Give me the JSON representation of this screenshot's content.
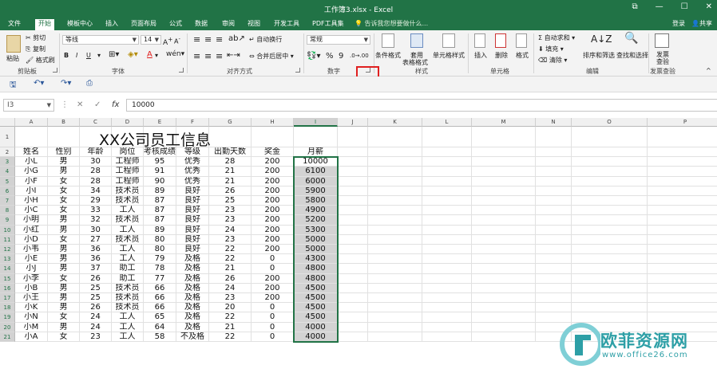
{
  "window": {
    "title": "工作簿3.xlsx - Excel",
    "controls": [
      "restore-icon",
      "minimize-icon",
      "maximize-icon",
      "close-icon"
    ]
  },
  "tabs": [
    "文件",
    "开始",
    "模板中心",
    "插入",
    "页面布局",
    "公式",
    "数据",
    "审阅",
    "视图",
    "开发工具",
    "PDF工具集"
  ],
  "active_tab": "开始",
  "tell_me": "告诉我您想要做什么...",
  "account": {
    "login": "登录",
    "share": "共享"
  },
  "ribbon": {
    "clipboard": {
      "paste": "粘贴",
      "cut": "剪切",
      "copy": "复制",
      "format_painter": "格式刷",
      "label": "剪贴板"
    },
    "font": {
      "name": "等线",
      "size": "14",
      "bold": "B",
      "italic": "I",
      "underline": "U",
      "label": "字体",
      "font_color": "#e0201e"
    },
    "alignment": {
      "wrap": "自动换行",
      "merge": "合并后居中",
      "label": "对齐方式"
    },
    "number": {
      "format": "常规",
      "percent": "%",
      "comma": "9",
      "label": "数字"
    },
    "styles": {
      "conditional": "条件格式",
      "table_format_1": "套用",
      "table_format_2": "表格格式",
      "cell_styles": "单元格样式",
      "label": "样式"
    },
    "cells": {
      "insert": "插入",
      "delete": "删除",
      "format": "格式",
      "label": "单元格"
    },
    "editing": {
      "autosum": "自动求和",
      "fill": "填充",
      "clear": "清除",
      "sort": "排序和筛选",
      "find": "查找和选择",
      "label": "编辑"
    },
    "check": {
      "check_1": "发票",
      "check_2": "查验",
      "label": "发票查验"
    }
  },
  "formula_bar": {
    "name_box": "I3",
    "cancel": "✕",
    "enter": "✓",
    "fx": "fx",
    "value": "10000"
  },
  "sheet": {
    "columns": [
      "A",
      "B",
      "C",
      "D",
      "E",
      "F",
      "G",
      "H",
      "I",
      "J",
      "K",
      "L",
      "M",
      "N",
      "O",
      "P"
    ],
    "row_numbers": [
      "1",
      "2",
      "3",
      "4",
      "5",
      "6",
      "7",
      "8",
      "9",
      "10",
      "11",
      "12",
      "13",
      "14",
      "15",
      "16",
      "17",
      "18",
      "19",
      "20",
      "21"
    ],
    "title": "XX公司员工信息",
    "headers": [
      "姓名",
      "性别",
      "年龄",
      "岗位",
      "考核成绩",
      "等级",
      "出勤天数",
      "奖金",
      "月薪"
    ],
    "rows": [
      [
        "小L",
        "男",
        "30",
        "工程师",
        "95",
        "优秀",
        "28",
        "200",
        "10000"
      ],
      [
        "小G",
        "男",
        "28",
        "工程师",
        "91",
        "优秀",
        "21",
        "200",
        "6100"
      ],
      [
        "小F",
        "女",
        "28",
        "工程师",
        "90",
        "优秀",
        "21",
        "200",
        "6000"
      ],
      [
        "小I",
        "女",
        "34",
        "技术员",
        "89",
        "良好",
        "26",
        "200",
        "5900"
      ],
      [
        "小H",
        "女",
        "29",
        "技术员",
        "87",
        "良好",
        "25",
        "200",
        "5800"
      ],
      [
        "小C",
        "女",
        "33",
        "工人",
        "87",
        "良好",
        "23",
        "200",
        "4900"
      ],
      [
        "小明",
        "男",
        "32",
        "技术员",
        "87",
        "良好",
        "23",
        "200",
        "5200"
      ],
      [
        "小红",
        "男",
        "30",
        "工人",
        "89",
        "良好",
        "24",
        "200",
        "5300"
      ],
      [
        "小D",
        "女",
        "27",
        "技术员",
        "80",
        "良好",
        "23",
        "200",
        "5000"
      ],
      [
        "小韦",
        "男",
        "36",
        "工人",
        "80",
        "良好",
        "22",
        "200",
        "5000"
      ],
      [
        "小E",
        "男",
        "36",
        "工人",
        "79",
        "及格",
        "22",
        "0",
        "4300"
      ],
      [
        "小J",
        "男",
        "37",
        "助工",
        "78",
        "及格",
        "21",
        "0",
        "4800"
      ],
      [
        "小李",
        "女",
        "26",
        "助工",
        "77",
        "及格",
        "26",
        "200",
        "4800"
      ],
      [
        "小B",
        "男",
        "25",
        "技术员",
        "66",
        "及格",
        "24",
        "200",
        "4500"
      ],
      [
        "小王",
        "男",
        "25",
        "技术员",
        "66",
        "及格",
        "23",
        "200",
        "4500"
      ],
      [
        "小K",
        "男",
        "26",
        "技术员",
        "66",
        "及格",
        "20",
        "0",
        "4500"
      ],
      [
        "小N",
        "女",
        "24",
        "工人",
        "65",
        "及格",
        "22",
        "0",
        "4500"
      ],
      [
        "小M",
        "男",
        "24",
        "工人",
        "64",
        "及格",
        "21",
        "0",
        "4000"
      ],
      [
        "小A",
        "女",
        "23",
        "工人",
        "58",
        "不及格",
        "22",
        "0",
        "4000"
      ]
    ]
  },
  "watermark": {
    "text": "欧菲资源网",
    "url": "www.office26.com"
  },
  "colors": {
    "excel_green": "#217346",
    "highlight_red": "#e02020",
    "selection_fill": "#d3d3d3",
    "watermark": "#2d9fa6"
  }
}
